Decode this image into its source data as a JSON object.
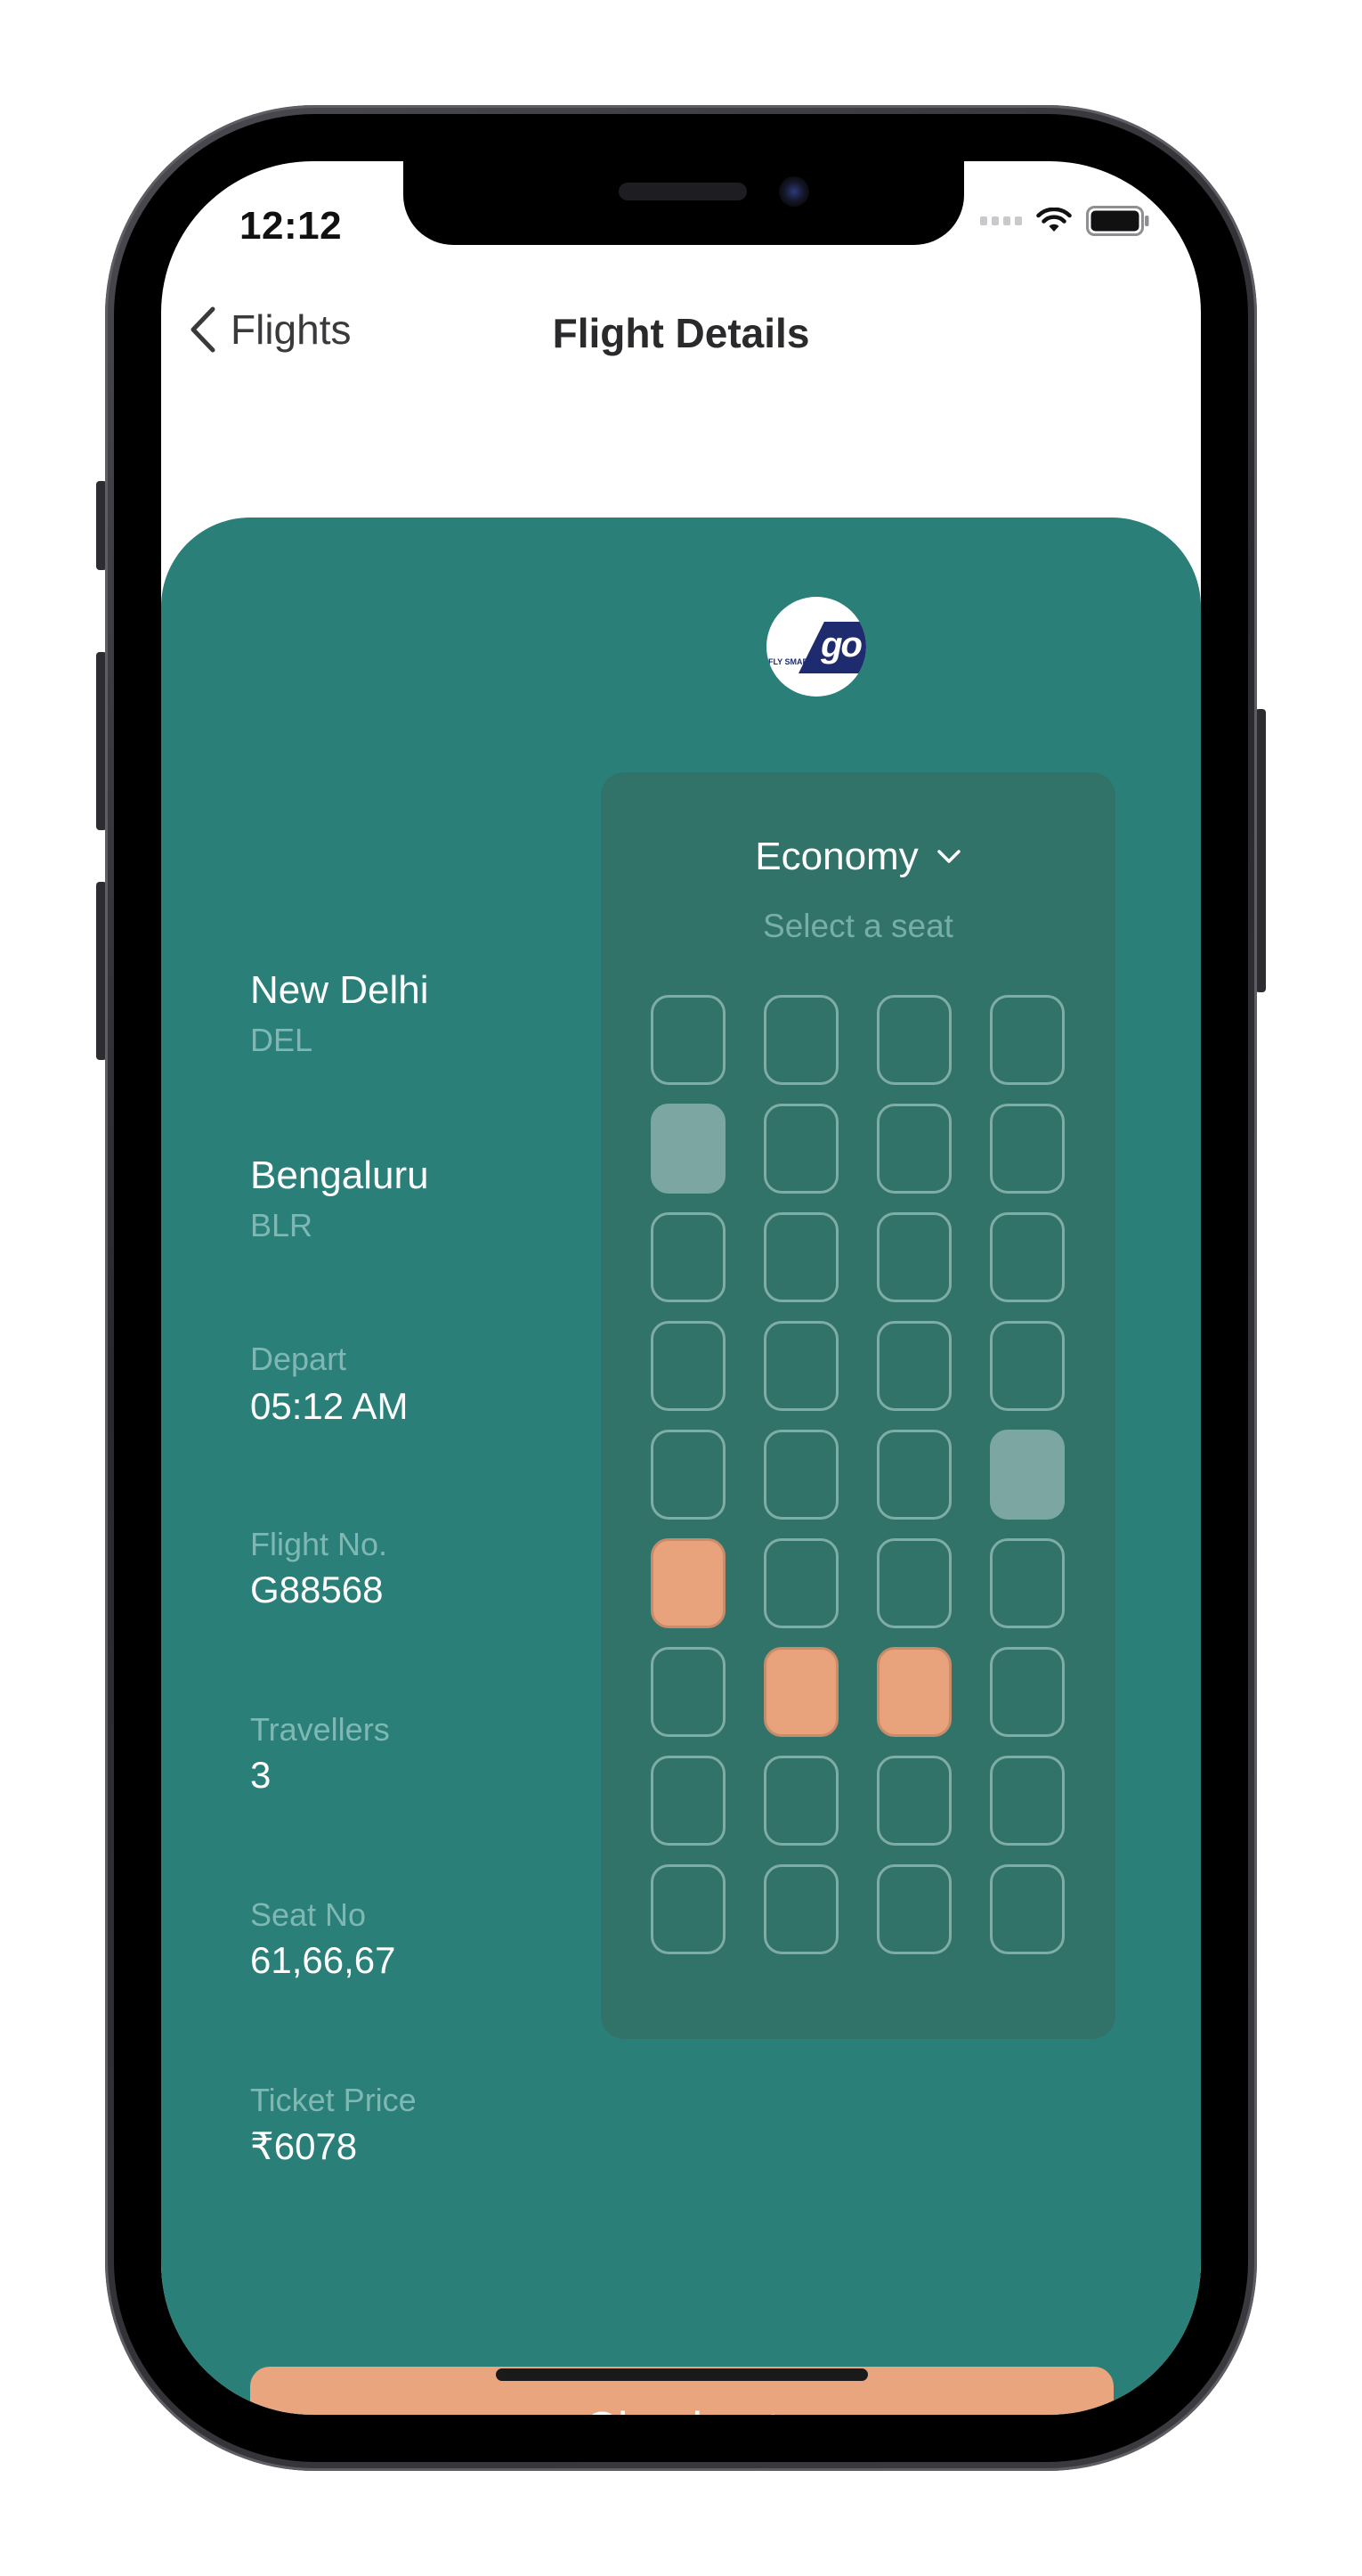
{
  "status_bar": {
    "time": "12:12",
    "icons": [
      "signal-icon",
      "wifi-icon",
      "battery-icon"
    ]
  },
  "nav": {
    "back_label": "Flights",
    "title": "Flight Details"
  },
  "airline": {
    "logo_text": "go",
    "logo_tagline": "FLY SMART"
  },
  "route": {
    "origin_city": "New Delhi",
    "origin_code": "DEL",
    "destination_city": "Bengaluru",
    "destination_code": "BLR"
  },
  "details": [
    {
      "label": "Depart",
      "value": "05:12 AM"
    },
    {
      "label": "Flight No.",
      "value": "G88568"
    },
    {
      "label": "Travellers",
      "value": "3"
    },
    {
      "label": "Seat No",
      "value": "61,66,67"
    },
    {
      "label": "Ticket Price",
      "value": "₹6078"
    }
  ],
  "seat_selector": {
    "class_selected": "Economy",
    "hint": "Select a seat",
    "columns": 4,
    "rows": [
      [
        "available",
        "available",
        "available",
        "available"
      ],
      [
        "booked",
        "available",
        "available",
        "available"
      ],
      [
        "available",
        "available",
        "available",
        "available"
      ],
      [
        "available",
        "available",
        "available",
        "available"
      ],
      [
        "available",
        "available",
        "available",
        "booked"
      ],
      [
        "selected",
        "available",
        "available",
        "available"
      ],
      [
        "available",
        "selected",
        "selected",
        "available"
      ],
      [
        "available",
        "available",
        "available",
        "available"
      ],
      [
        "available",
        "available",
        "available",
        "available"
      ]
    ]
  },
  "checkout": {
    "label": "Checkout"
  },
  "colors": {
    "card": "#2a7f78",
    "seat_panel": "#317369",
    "accent": "#e9a57e",
    "booked_seat": "#7ca6a2"
  }
}
